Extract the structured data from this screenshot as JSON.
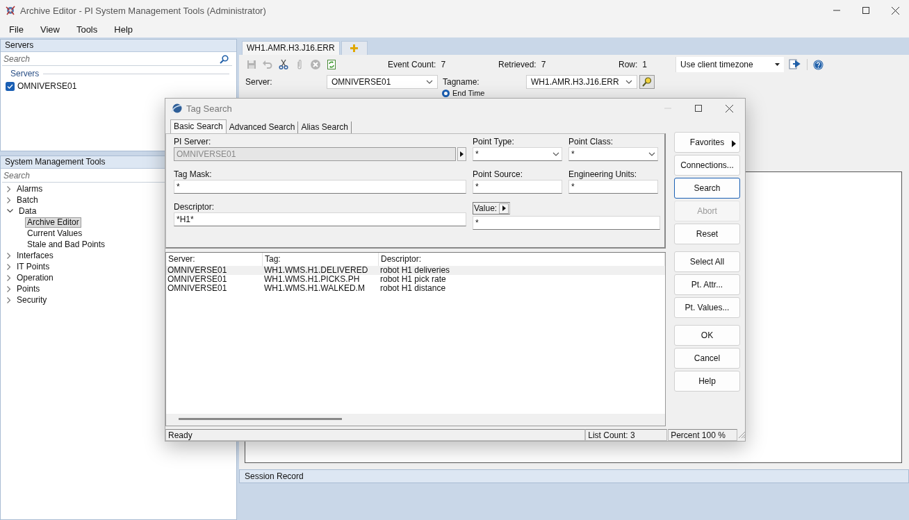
{
  "window": {
    "title": "Archive Editor - PI System Management Tools (Administrator)"
  },
  "menu": [
    {
      "label": "File"
    },
    {
      "label": "View"
    },
    {
      "label": "Tools"
    },
    {
      "label": "Help"
    }
  ],
  "servers_pane": {
    "title": "Servers",
    "search": {
      "placeholder": "Search"
    },
    "group": "Servers",
    "servers": [
      {
        "name": "OMNIVERSE01",
        "checked": true
      }
    ]
  },
  "tools_pane": {
    "title": "System Management Tools",
    "search": {
      "placeholder": "Search"
    },
    "tree": [
      {
        "label": "Alarms",
        "expanded": false,
        "selected": false
      },
      {
        "label": "Batch",
        "expanded": false,
        "selected": false
      },
      {
        "label": "Data",
        "expanded": true,
        "selected": false,
        "children": [
          {
            "label": "Archive Editor",
            "selected": true
          },
          {
            "label": "Current Values",
            "selected": false
          },
          {
            "label": "Stale and Bad Points",
            "selected": false
          }
        ]
      },
      {
        "label": "Interfaces",
        "expanded": false,
        "selected": false
      },
      {
        "label": "IT Points",
        "expanded": false,
        "selected": false
      },
      {
        "label": "Operation",
        "expanded": false,
        "selected": false
      },
      {
        "label": "Points",
        "expanded": false,
        "selected": false
      },
      {
        "label": "Security",
        "expanded": false,
        "selected": false
      }
    ]
  },
  "editor": {
    "tabs": [
      {
        "label": "WH1.AMR.H3.J16.ERR",
        "selected": true
      }
    ],
    "toolbar": [
      {
        "kind": "save",
        "disabled": true
      },
      {
        "kind": "undo",
        "disabled": true
      },
      {
        "kind": "cut",
        "disabled": false
      },
      {
        "kind": "attach",
        "disabled": true
      },
      {
        "kind": "cancel",
        "disabled": true
      },
      {
        "kind": "refresh",
        "disabled": false
      }
    ],
    "stats": [
      {
        "label": "Event Count:",
        "value": "7"
      },
      {
        "label": "Retrieved:",
        "value": "7"
      },
      {
        "label": "Row:",
        "value": "1"
      }
    ],
    "timezone": "Use client timezone",
    "server": {
      "label": "Server:",
      "value": "OMNIVERSE01"
    },
    "tagname": {
      "label": "Tagname:",
      "value": "WH1.AMR.H3.J16.ERR"
    },
    "end_time": {
      "label": "End Time",
      "selected": true
    },
    "session_record": "Session Record"
  },
  "dialog": {
    "title": "Tag Search",
    "tabs": [
      {
        "label": "Basic Search",
        "selected": true
      },
      {
        "label": "Advanced Search",
        "selected": false
      },
      {
        "label": "Alias Search",
        "selected": false
      }
    ],
    "pi_server": {
      "label": "PI Server:",
      "value": "OMNIVERSE01",
      "disabled": true
    },
    "point_type": {
      "label": "Point Type:",
      "value": "*"
    },
    "point_class": {
      "label": "Point Class:",
      "value": "*"
    },
    "tag_mask": {
      "label": "Tag Mask:",
      "value": "*"
    },
    "point_source": {
      "label": "Point Source:",
      "value": "*"
    },
    "engineering_units": {
      "label": "Engineering Units:",
      "value": "*"
    },
    "descriptor": {
      "label": "Descriptor:",
      "value": "*H1*"
    },
    "value": {
      "label": "Value:",
      "value": "*"
    },
    "results": {
      "columns": [
        "Server:",
        "Tag:",
        "Descriptor:"
      ],
      "rows": [
        {
          "cells": [
            "OMNIVERSE01",
            "WH1.WMS.H1.DELIVERED",
            "robot H1 deliveries"
          ],
          "selected": true
        },
        {
          "cells": [
            "OMNIVERSE01",
            "WH1.WMS.H1.PICKS.PH",
            "robot H1 pick rate"
          ],
          "selected": false
        },
        {
          "cells": [
            "OMNIVERSE01",
            "WH1.WMS.H1.WALKED.M",
            "robot H1 distance"
          ],
          "selected": false
        }
      ]
    },
    "button_groups": [
      [
        {
          "label": "Favorites",
          "kind": "menu",
          "disabled": false,
          "focused": false
        },
        {
          "label": "Connections...",
          "kind": "push",
          "disabled": false,
          "focused": false
        },
        {
          "label": "Search",
          "kind": "push",
          "disabled": false,
          "focused": true
        },
        {
          "label": "Abort",
          "kind": "push",
          "disabled": true,
          "focused": false
        },
        {
          "label": "Reset",
          "kind": "push",
          "disabled": false,
          "focused": false
        }
      ],
      [
        {
          "label": "Select All",
          "kind": "push",
          "disabled": false,
          "focused": false
        },
        {
          "label": "Pt. Attr...",
          "kind": "push",
          "disabled": false,
          "focused": false
        },
        {
          "label": "Pt. Values...",
          "kind": "push",
          "disabled": false,
          "focused": false
        }
      ],
      [
        {
          "label": "OK",
          "kind": "push",
          "disabled": false,
          "focused": false
        },
        {
          "label": "Cancel",
          "kind": "push",
          "disabled": false,
          "focused": false
        },
        {
          "label": "Help",
          "kind": "push",
          "disabled": false,
          "focused": false
        }
      ]
    ],
    "status_bar": {
      "status": "Ready",
      "list_count": "List Count: 3",
      "percent": "Percent 100 %"
    }
  }
}
